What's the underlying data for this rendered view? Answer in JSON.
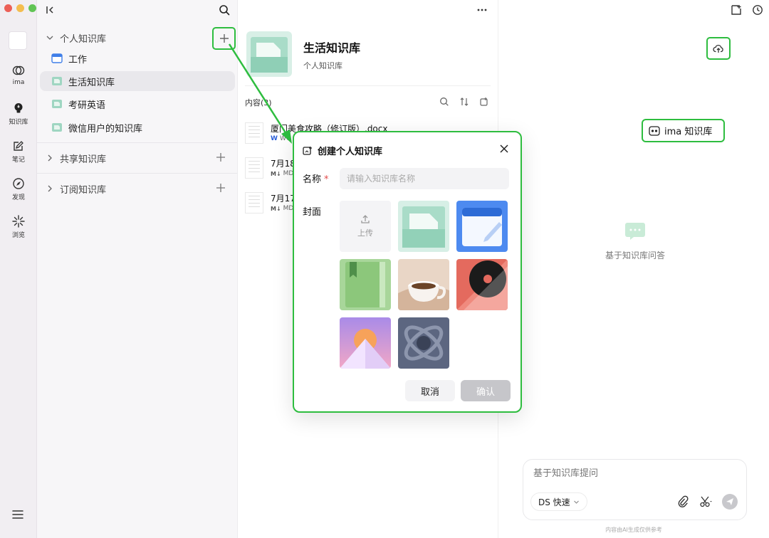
{
  "rail": {
    "items": [
      {
        "label": "ima",
        "icon": "ima-logo-icon"
      },
      {
        "label": "知识库",
        "icon": "bulb-icon"
      },
      {
        "label": "笔记",
        "icon": "note-icon"
      },
      {
        "label": "发现",
        "icon": "compass-icon"
      },
      {
        "label": "浏览",
        "icon": "sparkle-icon"
      }
    ]
  },
  "sidebar": {
    "personal": {
      "title": "个人知识库",
      "items": [
        "工作",
        "生活知识库",
        "考研英语",
        "微信用户的知识库"
      ],
      "active": "生活知识库"
    },
    "shared": {
      "title": "共享知识库"
    },
    "subscribed": {
      "title": "订阅知识库"
    }
  },
  "main": {
    "kb_title": "生活知识库",
    "kb_subtitle": "个人知识库",
    "content_label": "内容(3)",
    "files": [
      {
        "name": "厦门美食攻略（修订版）.docx",
        "type": "WO"
      },
      {
        "name": "7月18",
        "type": "MD"
      },
      {
        "name": "7月17",
        "type": "MD"
      }
    ]
  },
  "right": {
    "ima_kb_label": "ima 知识库",
    "empty_text": "基于知识库问答",
    "composer_placeholder": "基于知识库提问",
    "model_label": "DS 快速",
    "disclaimer": "内容由AI生成仅供参考"
  },
  "dialog": {
    "title": "创建个人知识库",
    "name_label": "名称",
    "required_mark": "*",
    "name_placeholder": "请输入知识库名称",
    "cover_label": "封面",
    "upload_label": "上传",
    "cancel_label": "取消",
    "confirm_label": "确认"
  },
  "colors": {
    "highlight": "#2ebd3f",
    "required": "#e24a4a",
    "cover_teal": "#9fd6c2",
    "cover_blue": "#3f7ee8",
    "cover_green": "#8cc77b",
    "cover_red": "#e46a5e"
  }
}
